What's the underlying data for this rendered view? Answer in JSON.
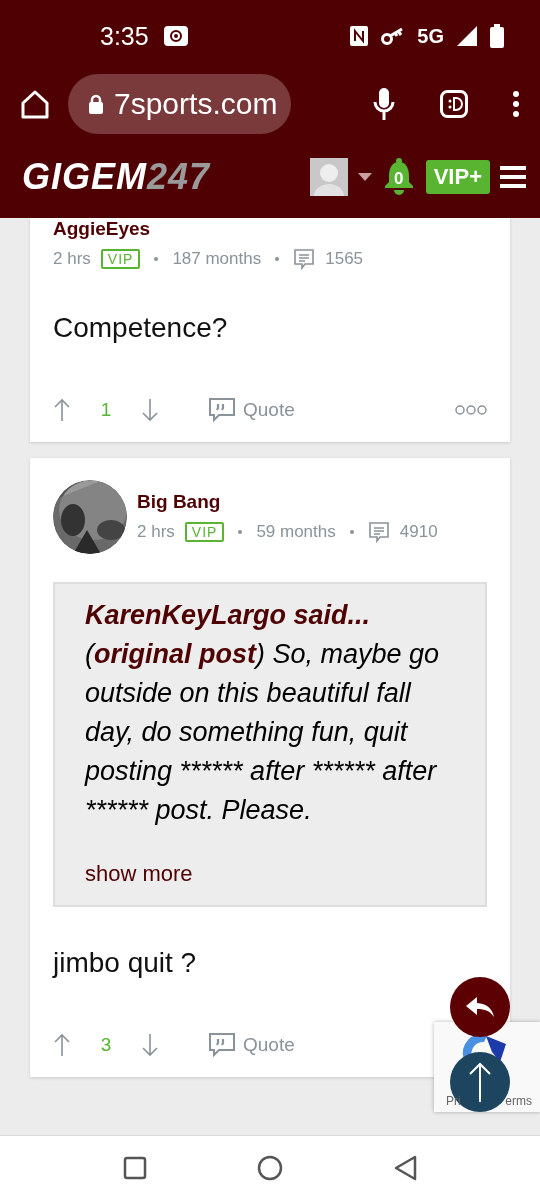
{
  "status_bar": {
    "time": "3:35",
    "network": "5G"
  },
  "browser": {
    "url": "7sports.com"
  },
  "site_header": {
    "logo_main": "GIGEM",
    "logo_number": "247",
    "notification_count": "0",
    "vip_button": "VIP+"
  },
  "posts": [
    {
      "author": "AggieEyes",
      "has_avatar": false,
      "time": "2 hrs",
      "badge": "VIP",
      "tenure": "187 months",
      "post_count": "1565",
      "body": "Competence?",
      "votes": "1",
      "quote_label": "Quote",
      "has_more": true
    },
    {
      "author": "Big Bang",
      "has_avatar": true,
      "time": "2 hrs",
      "badge": "VIP",
      "tenure": "59 months",
      "post_count": "4910",
      "quote": {
        "author_line": "KarenKeyLargo said...",
        "text_open": "(",
        "text_bold": "original post",
        "text_rest": ") So, maybe go outside on this beautiful fall day, do something fun, quit posting ****** after ****** after ****** post. Please.",
        "show_more": "show more"
      },
      "body": "jimbo quit ?",
      "votes": "3",
      "quote_label": "Quote",
      "has_more": false
    }
  ],
  "recaptcha": {
    "text_left": "Pri",
    "text_right": "erms"
  }
}
